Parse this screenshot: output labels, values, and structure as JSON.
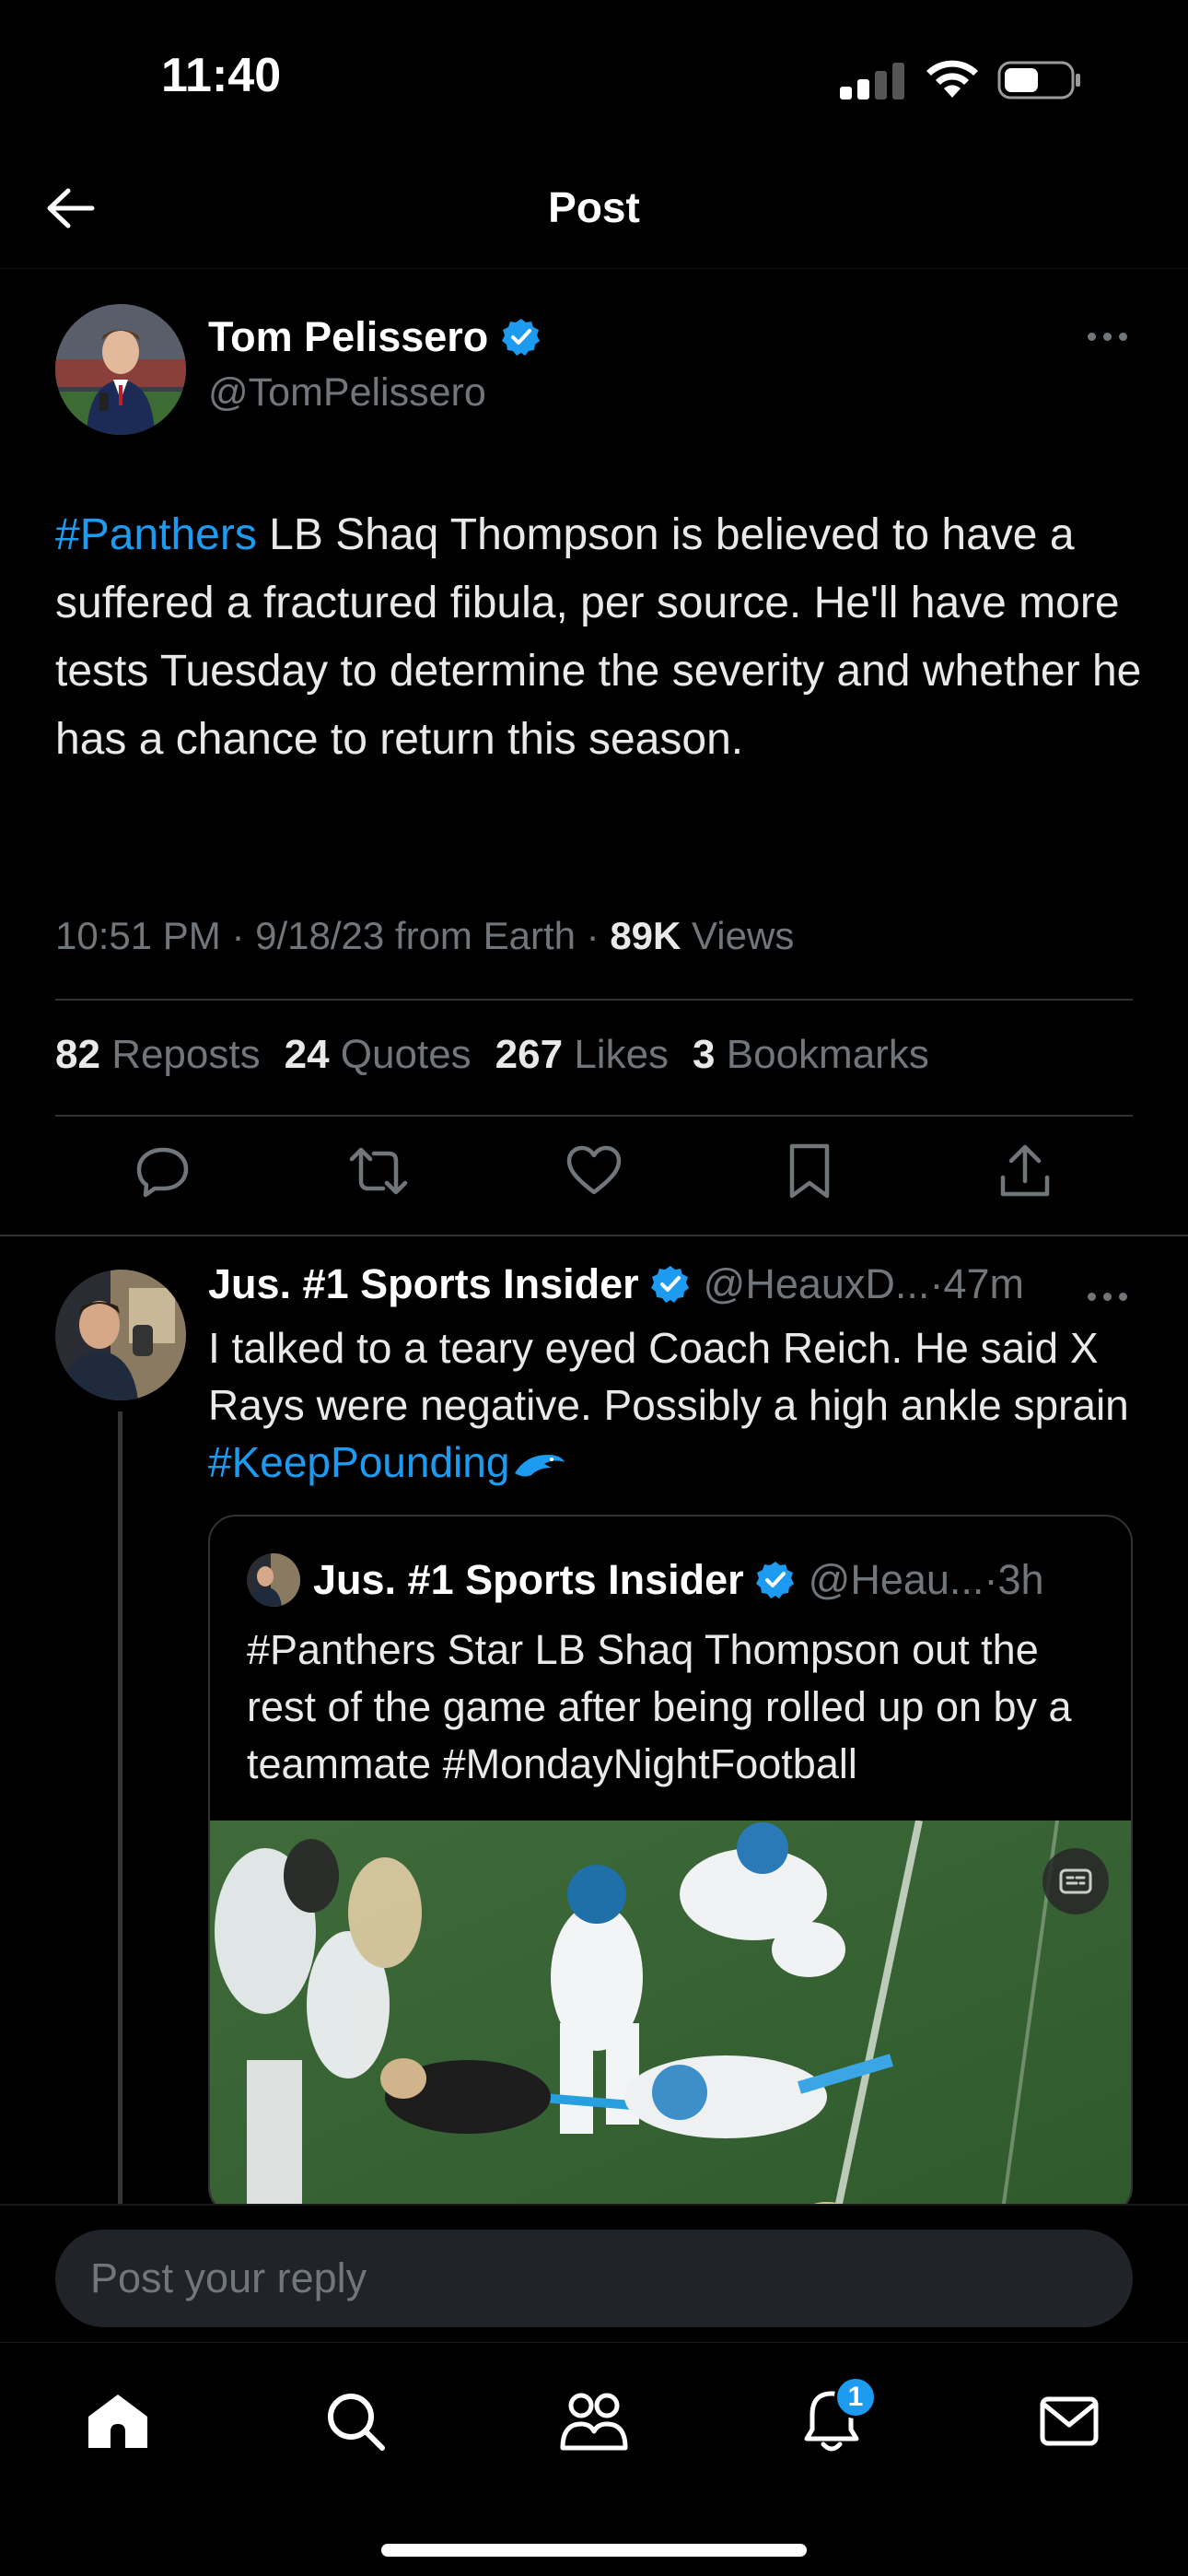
{
  "status_bar": {
    "time": "11:40"
  },
  "header": {
    "title": "Post",
    "back_icon": "arrow-left-icon"
  },
  "post": {
    "author_name": "Tom Pelissero",
    "author_handle": "@TomPelissero",
    "verified": true,
    "body_hashtag": "#Panthers",
    "body_text": " LB Shaq Thompson is believed to have a suffered a fractured fibula, per source. He'll have more tests Tuesday to determine the severity and whether he has a chance to return this season.",
    "time": "10:51 PM",
    "date": "9/18/23",
    "source": "from Earth",
    "views_count": "89K",
    "views_label": "Views",
    "stats": {
      "reposts_count": "82",
      "reposts_label": "Reposts",
      "quotes_count": "24",
      "quotes_label": "Quotes",
      "likes_count": "267",
      "likes_label": "Likes",
      "bookmarks_count": "3",
      "bookmarks_label": "Bookmarks"
    }
  },
  "reply": {
    "author_name": "Jus. #1 Sports Insider",
    "author_handle": "@HeauxD...",
    "time": "47m",
    "body_text": "I talked to a teary eyed Coach Reich. He said X Rays were negative. Possibly a high ankle sprain ",
    "body_hashtag": "#KeepPounding",
    "quote": {
      "author_name": "Jus. #1 Sports Insider",
      "author_handle": "@Heau...",
      "time": "3h",
      "body_text": "#Panthers Star LB Shaq Thompson out the rest of the game after being rolled up on by a teammate #MondayNightFootball"
    }
  },
  "reply_bar": {
    "placeholder": "Post your reply"
  },
  "tabbar": {
    "notifications_badge": "1",
    "items": [
      "home-icon",
      "search-icon",
      "communities-icon",
      "notifications-icon",
      "messages-icon"
    ]
  },
  "colors": {
    "accent": "#1d9bf0",
    "secondary_text": "#71767b",
    "background": "#000000"
  }
}
